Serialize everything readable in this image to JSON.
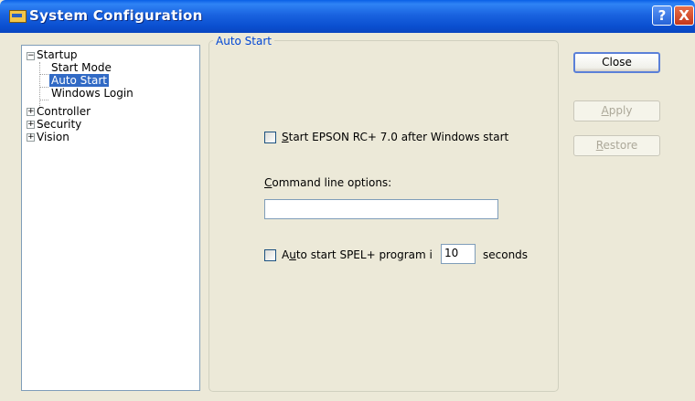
{
  "window": {
    "title": "System Configuration",
    "help_glyph": "?",
    "close_glyph": "X"
  },
  "tree": {
    "nodes": [
      {
        "label": "Startup",
        "expander": "−"
      },
      {
        "label": "Start Mode"
      },
      {
        "label": "Auto Start",
        "selected": true
      },
      {
        "label": "Windows Login"
      },
      {
        "label": "Controller",
        "expander": "+"
      },
      {
        "label": "Security",
        "expander": "+"
      },
      {
        "label": "Vision",
        "expander": "+"
      }
    ]
  },
  "panel": {
    "legend": "Auto Start",
    "start_checkbox": {
      "mnemonic": "S",
      "rest": "tart EPSON RC+ 7.0 after Windows start",
      "checked": false
    },
    "command_line": {
      "mnemonic": "C",
      "rest": "ommand line options:",
      "value": ""
    },
    "auto_checkbox": {
      "prefix": "A",
      "mnemonic": "u",
      "rest": "to start SPEL+ program i",
      "checked": false
    },
    "seconds_value": "10",
    "seconds_label": "seconds"
  },
  "buttons": {
    "close": {
      "label": "Close"
    },
    "apply": {
      "mnemonic": "A",
      "rest": "pply",
      "enabled": false
    },
    "restore": {
      "mnemonic": "R",
      "rest": "estore",
      "enabled": false
    }
  }
}
